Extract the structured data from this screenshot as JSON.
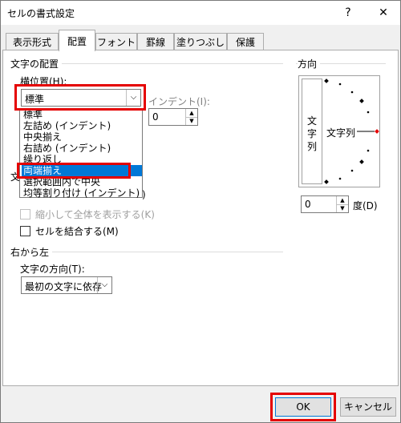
{
  "window": {
    "title": "セルの書式設定",
    "help": "?",
    "close": "✕"
  },
  "tabs": [
    {
      "label": "表示形式"
    },
    {
      "label": "配置"
    },
    {
      "label": "フォント"
    },
    {
      "label": "罫線"
    },
    {
      "label": "塗りつぶし"
    },
    {
      "label": "保護"
    }
  ],
  "text_alignment": {
    "group_title": "文字の配置",
    "horizontal_label": "横位置(H):",
    "horizontal_value": "標準",
    "horizontal_options": [
      "標準",
      "左詰め (インデント)",
      "中央揃え",
      "右詰め (インデント)",
      "繰り返し",
      "両端揃え",
      "選択範囲内で中央",
      "均等割り付け (インデント)"
    ],
    "selected_option": "両端揃え",
    "indent_label": "インデント(I):",
    "indent_value": "0"
  },
  "text_control": {
    "group_title_partial": "文",
    "partial_suffix": ")",
    "shrink_label": "縮小して全体を表示する(K)",
    "merge_label": "セルを結合する(M)"
  },
  "rtl": {
    "group_title": "右から左",
    "direction_label": "文字の方向(T):",
    "direction_value": "最初の文字に依存"
  },
  "orientation": {
    "group_title": "方向",
    "vertical_text": [
      "文",
      "字",
      "列"
    ],
    "horizontal_text": "文字列",
    "degree_value": "0",
    "degree_label": "度(D)"
  },
  "footer": {
    "ok": "OK",
    "cancel": "キャンセル"
  },
  "colors": {
    "highlight": "#e50000",
    "selection": "#0078d7"
  }
}
